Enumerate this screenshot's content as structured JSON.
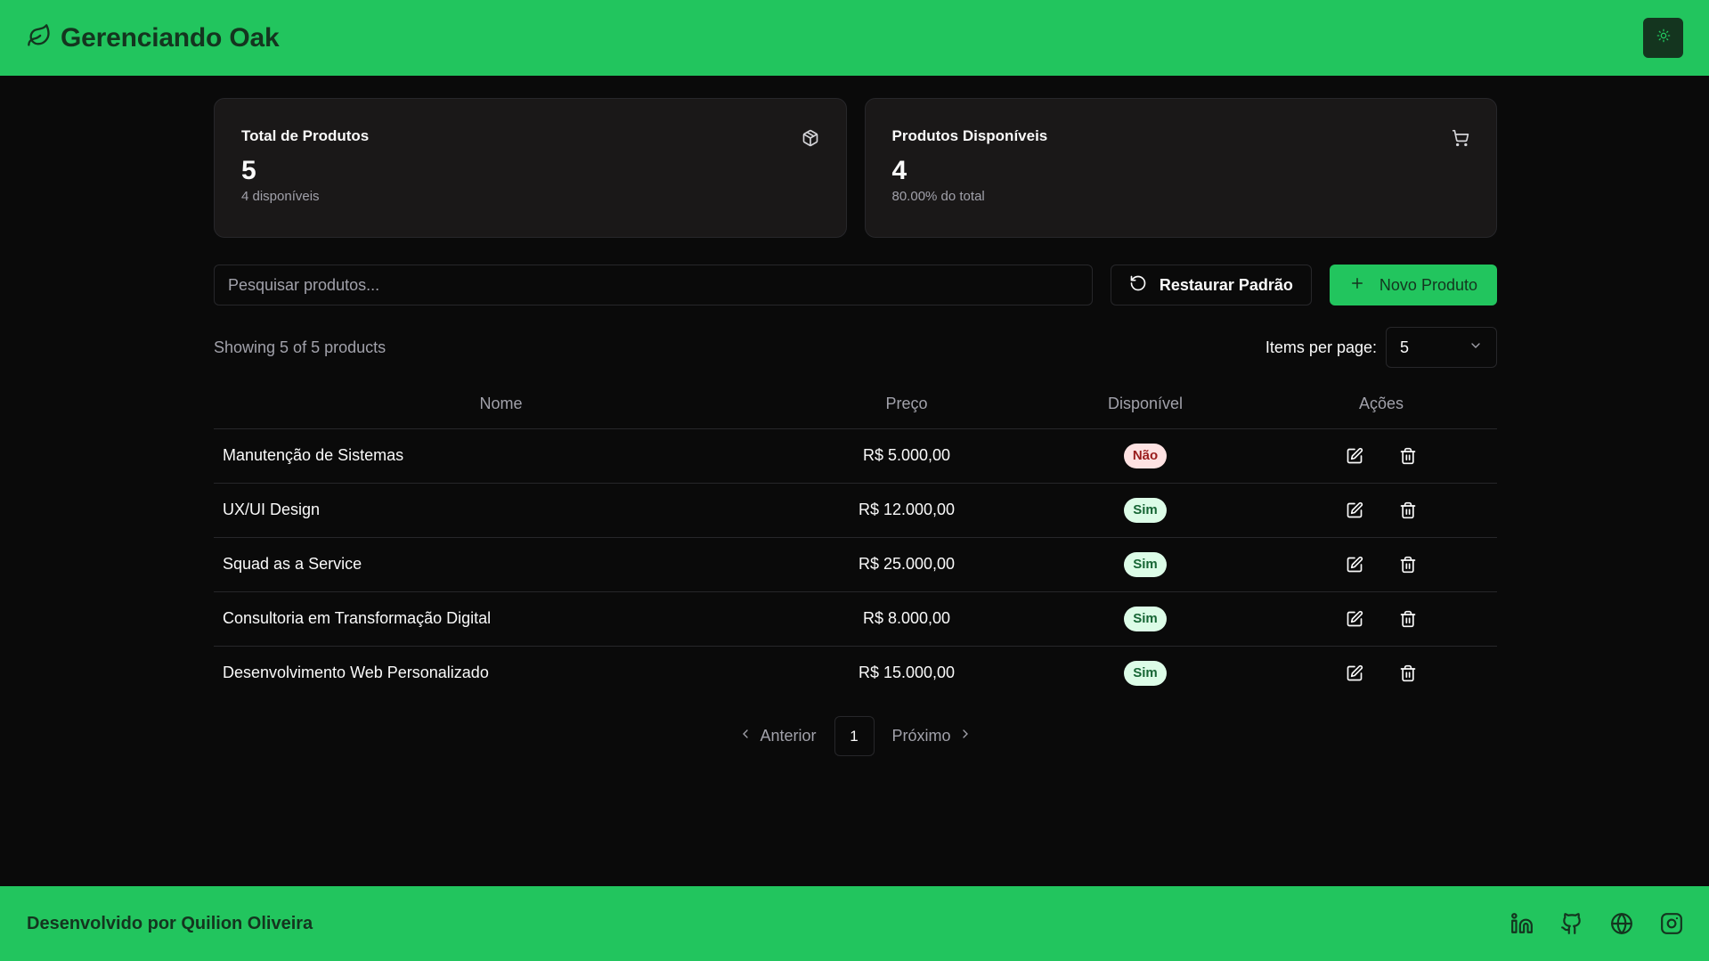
{
  "header": {
    "title": "Gerenciando Oak",
    "logo_icon": "leaf-icon",
    "theme_icon": "sun-icon"
  },
  "stats": {
    "total": {
      "title": "Total de Produtos",
      "value": "5",
      "sub": "4 disponíveis",
      "icon": "package-icon"
    },
    "available": {
      "title": "Produtos Disponíveis",
      "value": "4",
      "sub": "80.00% do total",
      "icon": "cart-icon"
    }
  },
  "toolbar": {
    "search_placeholder": "Pesquisar produtos...",
    "search_value": "",
    "restore_label": "Restaurar Padrão",
    "new_label": "Novo Produto"
  },
  "listing": {
    "showing": "Showing 5 of 5 products",
    "per_page_label": "Items per page:",
    "per_page_value": "5"
  },
  "table": {
    "headers": {
      "name": "Nome",
      "price": "Preço",
      "available": "Disponível",
      "actions": "Ações"
    },
    "rows": [
      {
        "name": "Manutenção de Sistemas",
        "price": "R$ 5.000,00",
        "available": "Não"
      },
      {
        "name": "UX/UI Design",
        "price": "R$ 12.000,00",
        "available": "Sim"
      },
      {
        "name": "Squad as a Service",
        "price": "R$ 25.000,00",
        "available": "Sim"
      },
      {
        "name": "Consultoria em Transformação Digital",
        "price": "R$ 8.000,00",
        "available": "Sim"
      },
      {
        "name": "Desenvolvimento Web Personalizado",
        "price": "R$ 15.000,00",
        "available": "Sim"
      }
    ]
  },
  "pagination": {
    "prev": "Anterior",
    "page": "1",
    "next": "Próximo"
  },
  "footer": {
    "text": "Desenvolvido por Quilion Oliveira",
    "socials": [
      "linkedin-icon",
      "github-icon",
      "globe-icon",
      "instagram-icon"
    ]
  },
  "colors": {
    "brand": "#22c55e",
    "brand_dark": "#14351f",
    "background": "#0a0a0a",
    "card": "#1a1818",
    "border": "#27272a"
  }
}
